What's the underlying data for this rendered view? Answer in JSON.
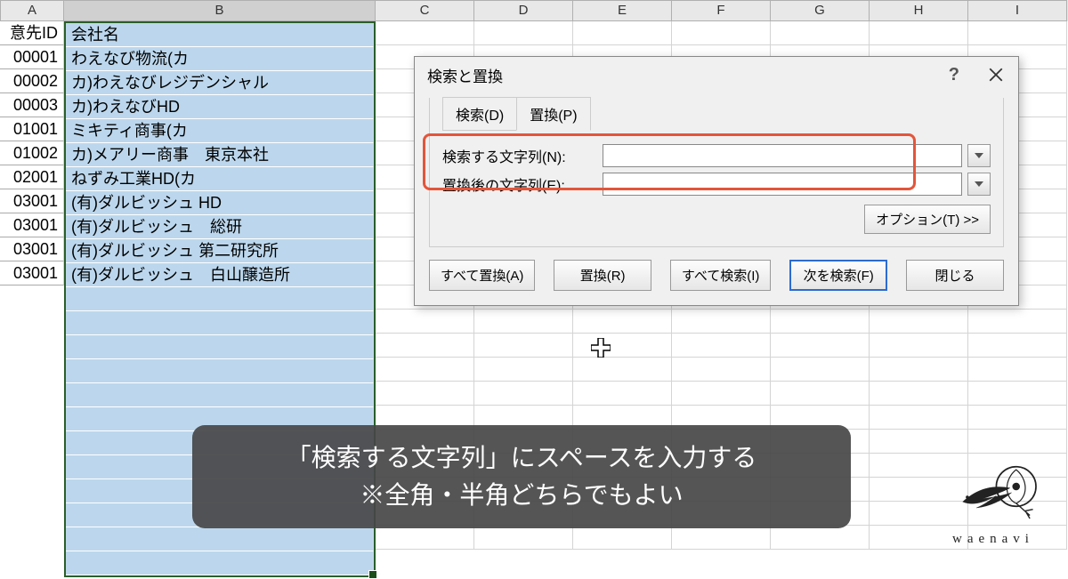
{
  "columns": [
    "A",
    "B",
    "C",
    "D",
    "E",
    "F",
    "G",
    "H",
    "I"
  ],
  "colA": {
    "header": "意先ID",
    "values": [
      "00001",
      "00002",
      "00003",
      "01001",
      "01002",
      "02001",
      "03001",
      "03001",
      "03001",
      "03001"
    ]
  },
  "colB": {
    "header": "会社名",
    "values": [
      "わえなび物流(カ",
      "カ)わえなびレジデンシャル",
      "カ)わえなびHD",
      "ミキティ商事(カ",
      "カ)メアリー商事　東京本社",
      "ねずみ工業HD(カ",
      "(有)ダルビッシュ HD",
      "(有)ダルビッシュ　総研",
      "(有)ダルビッシュ 第二研究所",
      "(有)ダルビッシュ　白山醸造所"
    ]
  },
  "dialog": {
    "title": "検索と置換",
    "tab_find": "検索(D)",
    "tab_replace": "置換(P)",
    "find_label": "検索する文字列(N):",
    "replace_label": "置換後の文字列(E):",
    "find_value": "",
    "replace_value": "",
    "options_btn": "オプション(T) >>",
    "btn_replace_all": "すべて置換(A)",
    "btn_replace": "置換(R)",
    "btn_find_all": "すべて検索(I)",
    "btn_find_next": "次を検索(F)",
    "btn_close": "閉じる"
  },
  "caption": {
    "line1": "「検索する文字列」にスペースを入力する",
    "line2": "※全角・半角どちらでもよい"
  },
  "logo_text": "waenavi"
}
